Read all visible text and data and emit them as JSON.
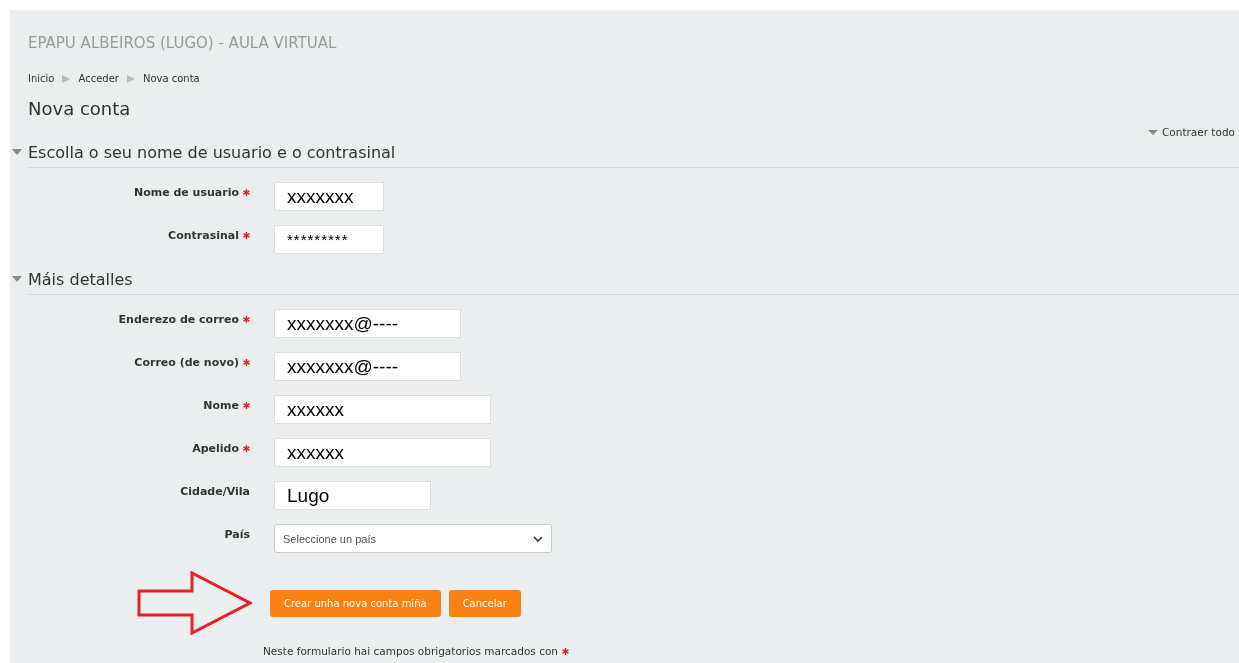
{
  "site_title": "EPAPU ALBEIROS (LUGO) - AULA VIRTUAL",
  "breadcrumb": [
    "Inicio",
    "Acceder",
    "Nova conta"
  ],
  "page_heading": "Nova conta",
  "collapse_all": "Contraer todo",
  "sections": [
    {
      "title": "Escolla o seu nome de usuario e o contrasinal",
      "expanded": true,
      "fields": [
        {
          "label": "Nome de usuario",
          "required": true,
          "kind": "text",
          "value": "xxxxxxx"
        },
        {
          "label": "Contrasinal",
          "required": true,
          "kind": "password",
          "value": "*********"
        }
      ]
    },
    {
      "title": "Máis detalles",
      "expanded": true,
      "fields": [
        {
          "label": "Enderezo de correo",
          "required": true,
          "kind": "text",
          "value": "xxxxxxx@----"
        },
        {
          "label": "Correo (de novo)",
          "required": true,
          "kind": "text",
          "value": "xxxxxxx@----"
        },
        {
          "label": "Nome",
          "required": true,
          "kind": "text",
          "value": "xxxxxx"
        },
        {
          "label": "Apelido",
          "required": true,
          "kind": "text",
          "value": "xxxxxx"
        },
        {
          "label": "Cidade/Vila",
          "required": false,
          "kind": "text",
          "value": "Lugo"
        },
        {
          "label": "País",
          "required": false,
          "kind": "select",
          "value": "Seleccione un país"
        }
      ]
    }
  ],
  "buttons": [
    {
      "label": "Crear unha nova conta miña"
    },
    {
      "label": "Cancelar"
    }
  ],
  "footnote": "Neste formulario hai campos obrigatorios marcados con"
}
